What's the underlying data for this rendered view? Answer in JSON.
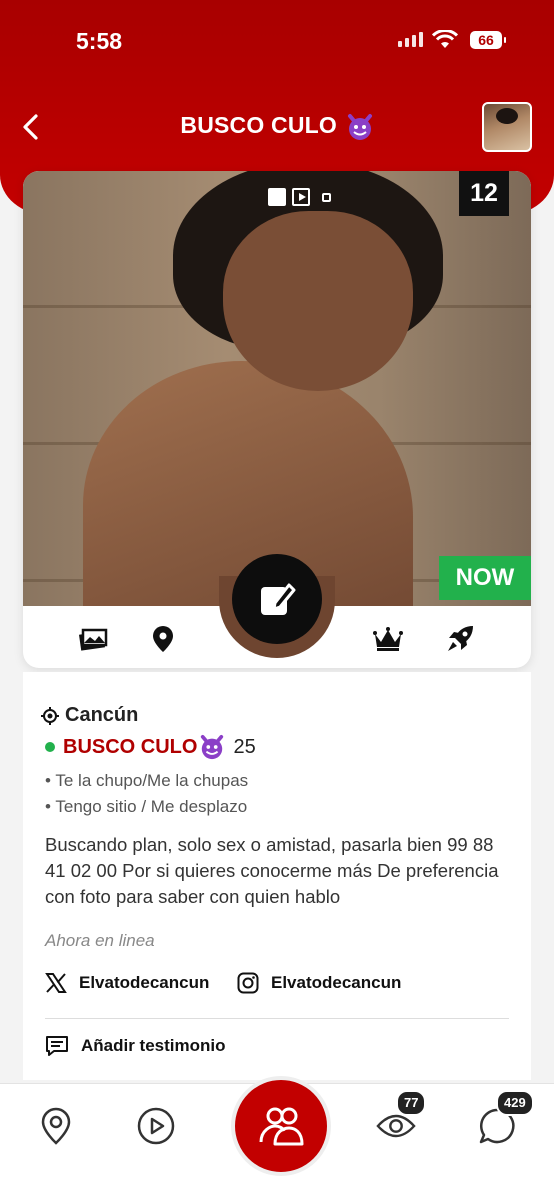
{
  "status_bar": {
    "time": "5:58",
    "battery": "66"
  },
  "nav": {
    "title": "BUSCO CULO"
  },
  "photo": {
    "count": "12",
    "now_label": "NOW"
  },
  "profile": {
    "city": "Cancún",
    "name": "BUSCO CULO",
    "age": "25",
    "tags": [
      "• Te la chupo/Me la chupas",
      "• Tengo sitio / Me desplazo"
    ],
    "description": "Buscando plan, solo sex o amistad, pasarla bien 99 88 41 02 00 Por si quieres conocerme más De preferencia con foto para saber con quien hablo",
    "last_seen": "Ahora en linea",
    "x_handle": "Elvatodecancun",
    "instagram_handle": "Elvatodecancun",
    "testimonial_label": "Añadir testimonio"
  },
  "tabbar": {
    "views_badge": "77",
    "messages_badge": "429"
  },
  "colors": {
    "brand_red": "#c20000",
    "online_green": "#22b14c",
    "now_green": "#22b14c"
  },
  "icons": [
    "back-icon",
    "photos-icon",
    "location-pin-icon",
    "edit-icon",
    "crown-icon",
    "rocket-icon",
    "target-icon",
    "x-logo-icon",
    "instagram-icon",
    "comment-icon",
    "map-pin-icon",
    "play-icon",
    "people-icon",
    "eye-icon",
    "chat-icon"
  ]
}
